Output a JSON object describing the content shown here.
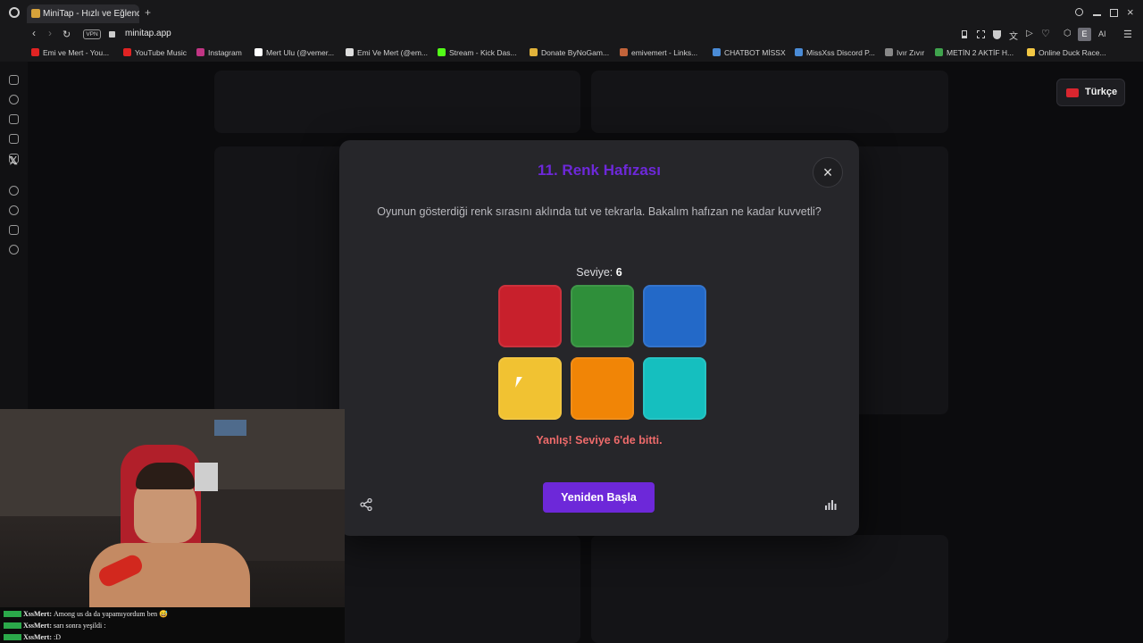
{
  "browser": {
    "tab_title": "MiniTap - Hızlı ve Eğlenceli",
    "vpn_label": "VPN",
    "url": "minitap.app",
    "ai_label": "AI",
    "profile_letter": "E",
    "bookmarks": [
      {
        "label": "Emi ve Mert - You...",
        "color": "#e02323"
      },
      {
        "label": "YouTube Music",
        "color": "#e02323"
      },
      {
        "label": "Instagram",
        "color": "#c13584"
      },
      {
        "label": "Mert Ulu (@vemer...",
        "color": "#ffffff"
      },
      {
        "label": "Emi Ve Mert (@em...",
        "color": "#dddddd"
      },
      {
        "label": "Stream - Kick Das...",
        "color": "#53fc18"
      },
      {
        "label": "Donate ByNoGam...",
        "color": "#e0b23a"
      },
      {
        "label": "emivemert - Links...",
        "color": "#c2633a"
      },
      {
        "label": "CHATBOT MİSSX",
        "color": "#4a8bd6"
      },
      {
        "label": "MissXss Discord P...",
        "color": "#4a8bd6"
      },
      {
        "label": "Ivır Zıvır",
        "color": "#888888"
      },
      {
        "label": "METİN 2 AKTİF H...",
        "color": "#3fa34d"
      },
      {
        "label": "Online Duck Race...",
        "color": "#f2c744"
      }
    ]
  },
  "language": {
    "label": "Türkçe"
  },
  "modal": {
    "title": "11. Renk Hafızası",
    "description": "Oyunun gösterdiği renk sırasını aklında tut ve tekrarla. Bakalım hafızan ne kadar kuvvetli?",
    "level_label": "Seviye:",
    "level_value": "6",
    "result": "Yanlış! Seviye 6'de bitti.",
    "restart_label": "Yeniden Başla",
    "close_icon": "×",
    "share_icon": "share-icon",
    "stats_icon": "stats-icon",
    "colors": [
      {
        "name": "red",
        "hex": "#c8202c"
      },
      {
        "name": "green",
        "hex": "#2f8f3a"
      },
      {
        "name": "blue",
        "hex": "#2369c8"
      },
      {
        "name": "yellow",
        "hex": "#f1c232"
      },
      {
        "name": "orange",
        "hex": "#f18506"
      },
      {
        "name": "cyan",
        "hex": "#15bfbf"
      }
    ]
  },
  "chat": [
    {
      "user": "XssMert:",
      "text": "Among us da da yapamıyordum ben 😅"
    },
    {
      "user": "XssMert:",
      "text": "sarı sonra yeşildi :"
    },
    {
      "user": "XssMert:",
      "text": ":D"
    }
  ]
}
